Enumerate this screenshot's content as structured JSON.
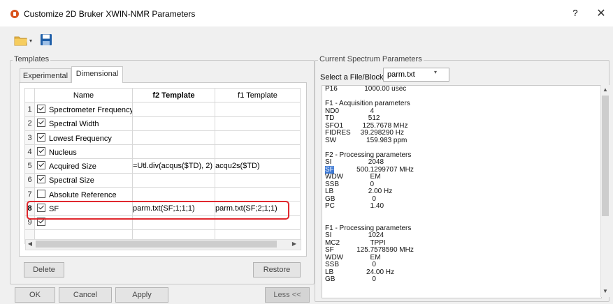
{
  "window": {
    "title": "Customize 2D Bruker XWIN-NMR Parameters",
    "help": "?",
    "close": "✕"
  },
  "toolbar": {
    "open_icon": "folder-icon",
    "dropdown_icon": "▾",
    "save_icon": "save-icon"
  },
  "templates": {
    "group_label": "Templates",
    "tabs": [
      {
        "label": "Experimental",
        "active": false
      },
      {
        "label": "Dimensional",
        "active": true
      }
    ],
    "columns": [
      "Name",
      "f2 Template",
      "f1 Template"
    ],
    "rows": [
      {
        "num": "1",
        "checked": true,
        "name": "Spectrometer Frequency",
        "f2": "",
        "f1": ""
      },
      {
        "num": "2",
        "checked": true,
        "name": "Spectral Width",
        "f2": "",
        "f1": ""
      },
      {
        "num": "3",
        "checked": true,
        "name": "Lowest Frequency",
        "f2": "",
        "f1": ""
      },
      {
        "num": "4",
        "checked": true,
        "name": "Nucleus",
        "f2": "",
        "f1": ""
      },
      {
        "num": "5",
        "checked": true,
        "name": "Acquired Size",
        "f2": "=Utl.div(acqus($TD), 2)",
        "f1": "acqu2s($TD)"
      },
      {
        "num": "6",
        "checked": true,
        "name": "Spectral Size",
        "f2": "",
        "f1": ""
      },
      {
        "num": "7",
        "checked": false,
        "name": "Absolute Reference",
        "f2": "",
        "f1": ""
      },
      {
        "num": "8",
        "checked": true,
        "name": "SF",
        "f2": "parm.txt(SF;1;1;1)",
        "f1": "parm.txt(SF;2;1;1)"
      },
      {
        "num": "9",
        "checked": true,
        "name": "",
        "f2": "",
        "f1": ""
      }
    ],
    "scroll_left": "◀",
    "scroll_right": "▶",
    "delete_label": "Delete",
    "restore_label": "Restore"
  },
  "current": {
    "group_label": "Current Spectrum Parameters",
    "select_label": "Select a File/Block:",
    "select_value": "parm.txt",
    "select_arrow": "▾",
    "scroll_up": "▲",
    "scroll_down": "▼",
    "lines": [
      {
        "k": "P16",
        "v": "        1000.00 usec"
      },
      {
        "k": "",
        "v": ""
      },
      {
        "k": "F1 - Acquisition parameters",
        "v": ""
      },
      {
        "k": "ND0",
        "v": "           4"
      },
      {
        "k": "TD",
        "v": "          512"
      },
      {
        "k": "SFO1",
        "v": "       125.7678 MHz"
      },
      {
        "k": "FIDRES",
        "v": "      39.298290 Hz"
      },
      {
        "k": "SW",
        "v": "         159.983 ppm"
      },
      {
        "k": "",
        "v": ""
      },
      {
        "k": "F2 - Processing parameters",
        "v": ""
      },
      {
        "k": "SI",
        "v": "          2048"
      },
      {
        "k": "SF",
        "v": "    500.1299707 MHz",
        "sel": true
      },
      {
        "k": "WDW",
        "v": "           EM"
      },
      {
        "k": "SSB",
        "v": "           0"
      },
      {
        "k": "LB",
        "v": "          2.00 Hz"
      },
      {
        "k": "GB",
        "v": "            0"
      },
      {
        "k": "PC",
        "v": "           1.40"
      },
      {
        "k": "",
        "v": ""
      },
      {
        "k": "",
        "v": ""
      },
      {
        "k": "F1 - Processing parameters",
        "v": ""
      },
      {
        "k": "SI",
        "v": "          1024"
      },
      {
        "k": "MC2",
        "v": "           TPPI"
      },
      {
        "k": "SF",
        "v": "    125.7578590 MHz"
      },
      {
        "k": "WDW",
        "v": "           EM"
      },
      {
        "k": "SSB",
        "v": "            0"
      },
      {
        "k": "LB",
        "v": "         24.00 Hz"
      },
      {
        "k": "GB",
        "v": "            0"
      }
    ]
  },
  "footer": {
    "ok_label": "OK",
    "cancel_label": "Cancel",
    "apply_label": "Apply",
    "less_label": "Less <<"
  }
}
